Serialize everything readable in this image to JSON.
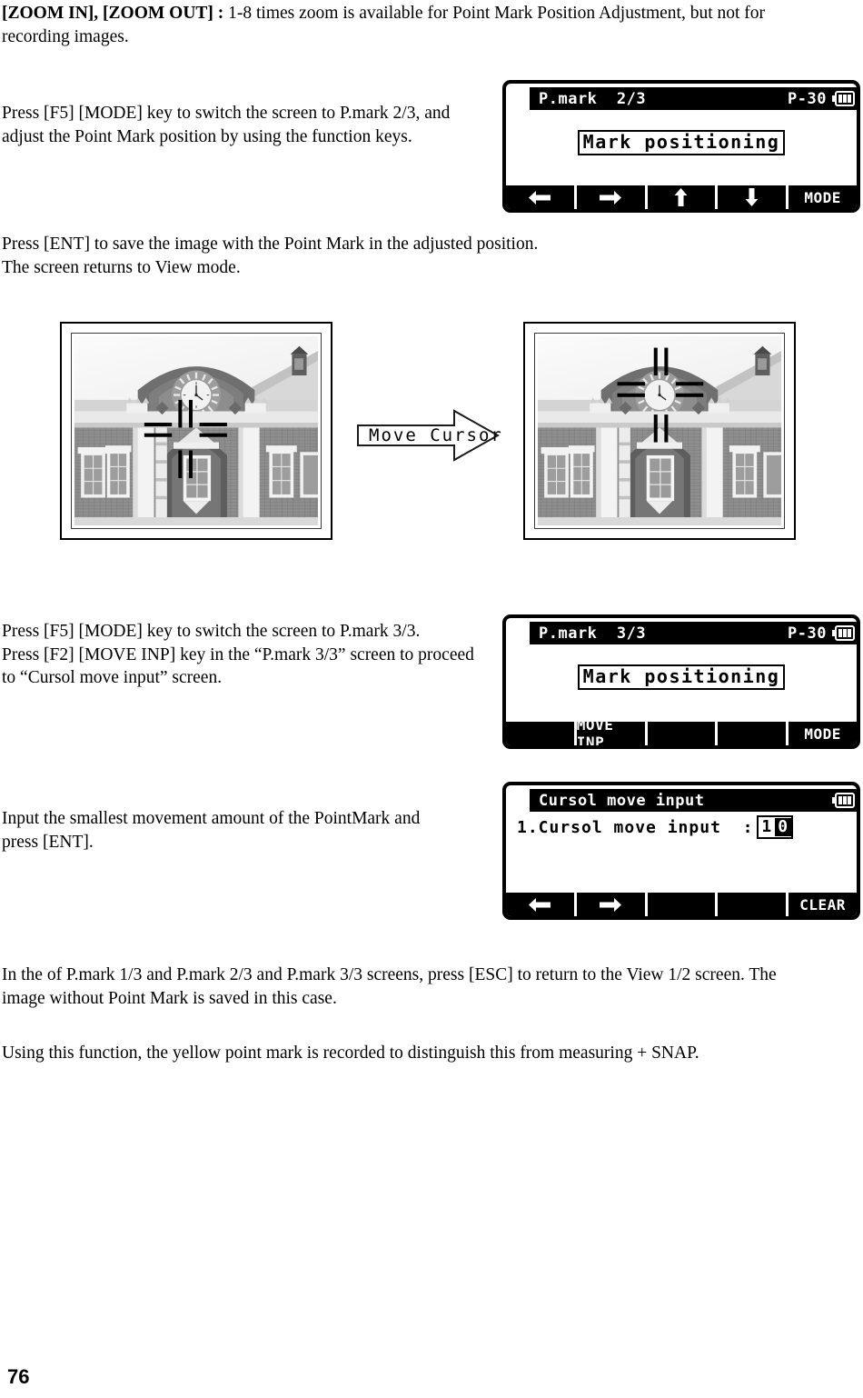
{
  "document": {
    "page_number": "76",
    "paragraphs": {
      "zoom_note_bold": "[ZOOM IN], [ZOOM OUT] :",
      "zoom_note_rest": " 1-8 times zoom is available for Point Mark Position Adjustment, but not for recording images.",
      "step_mode_2_3": "Press [F5] [MODE] key to switch the screen to P.mark 2/3, and  adjust the Point Mark position by using the function keys.",
      "step_ent_save": "Press [ENT] to save the image with the Point Mark in the adjusted position.\nThe screen returns to View mode.",
      "step_mode_3_3": "Press [F5] [MODE] key to switch the screen to P.mark 3/3.\nPress [F2] [MOVE INP] key in the “P.mark 3/3” screen to proceed to “Cursol move input” screen.",
      "step_input_amount": "Input the smallest movement amount of the PointMark and press [ENT].",
      "note_esc_return": "In the of  P.mark 1/3 and P.mark 2/3 and P.mark 3/3 screens, press [ESC] to return to the View 1/2 screen. The image without Point Mark is saved in this case.",
      "note_yellow_mark": "Using this function, the yellow point mark is recorded to distinguish this from measuring + SNAP."
    }
  },
  "lcd_screens": [
    {
      "id": "p-mark-2-3",
      "title_left": "P.mark  2/3",
      "title_right": "P-30",
      "battery_bars": 3,
      "body_text": "Mark positioning",
      "function_keys": [
        {
          "name": "f1-left-arrow",
          "label": "",
          "icon": "arrow-left-icon"
        },
        {
          "name": "f2-right-arrow",
          "label": "",
          "icon": "arrow-right-icon"
        },
        {
          "name": "f3-up-arrow",
          "label": "",
          "icon": "arrow-up-icon"
        },
        {
          "name": "f4-down-arrow",
          "label": "",
          "icon": "arrow-down-icon"
        },
        {
          "name": "f5-mode",
          "label": "MODE",
          "icon": ""
        }
      ]
    },
    {
      "id": "p-mark-3-3",
      "title_left": "P.mark  3/3",
      "title_right": "P-30",
      "battery_bars": 3,
      "body_text": "Mark positioning",
      "function_keys": [
        {
          "name": "f1-blank",
          "label": "",
          "icon": ""
        },
        {
          "name": "f2-move-inp",
          "label": "MOVE INP",
          "icon": ""
        },
        {
          "name": "f3-blank",
          "label": "",
          "icon": ""
        },
        {
          "name": "f4-blank",
          "label": "",
          "icon": ""
        },
        {
          "name": "f5-mode",
          "label": "MODE",
          "icon": ""
        }
      ]
    },
    {
      "id": "cursol-move-input",
      "title_left": "Cursol move input",
      "title_right": "",
      "battery_bars": 3,
      "field_label": "1.Cursol move input  :",
      "field_value_digits": [
        "1",
        "0"
      ],
      "field_selected_index": 1,
      "function_keys": [
        {
          "name": "f1-left-arrow",
          "label": "",
          "icon": "arrow-left-icon"
        },
        {
          "name": "f2-right-arrow",
          "label": "",
          "icon": "arrow-right-icon"
        },
        {
          "name": "f3-blank",
          "label": "",
          "icon": ""
        },
        {
          "name": "f4-blank",
          "label": "",
          "icon": ""
        },
        {
          "name": "f5-clear",
          "label": "CLEAR",
          "icon": ""
        }
      ]
    }
  ],
  "illustration": {
    "photo_before_caption": "",
    "photo_after_caption": "",
    "arrow_label": "Move Cursor"
  }
}
